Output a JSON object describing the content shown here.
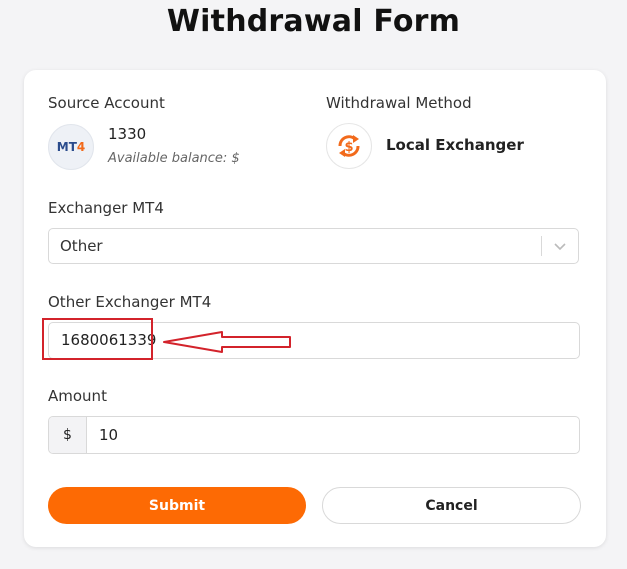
{
  "page": {
    "title": "Withdrawal Form"
  },
  "source": {
    "label": "Source Account",
    "badge_text": "MT",
    "badge_num": "4",
    "account_number": "1330",
    "balance_label": "Available balance: $"
  },
  "method": {
    "label": "Withdrawal Method",
    "name": "Local Exchanger",
    "icon": "dollar-exchange-icon"
  },
  "exchanger": {
    "label": "Exchanger MT4",
    "selected": "Other"
  },
  "other_exchanger": {
    "label": "Other Exchanger MT4",
    "value": "1680061339"
  },
  "amount": {
    "label": "Amount",
    "currency": "$",
    "value": "10"
  },
  "actions": {
    "submit": "Submit",
    "cancel": "Cancel"
  },
  "colors": {
    "accent": "#fd6a04",
    "annotation": "#d3232b"
  }
}
